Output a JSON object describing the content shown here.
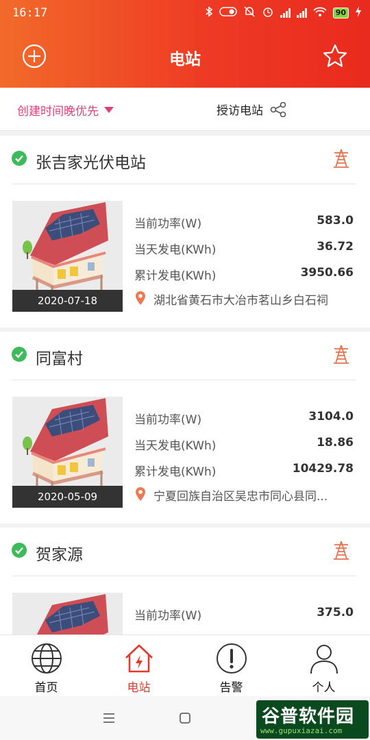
{
  "status": {
    "time": "16:17",
    "battery": "90"
  },
  "header": {
    "title": "电站",
    "add_icon": "plus-circle-icon",
    "favorite_icon": "star-icon"
  },
  "filter": {
    "sort_label": "创建时间晚优先",
    "visit_label": "授访电站",
    "share_icon": "share-icon"
  },
  "labels": {
    "power": "当前功率(W)",
    "today": "当天发电(KWh)",
    "total": "累计发电(KWh)"
  },
  "stations": [
    {
      "name": "张吉家光伏电站",
      "date": "2020-07-18",
      "power": "583.0",
      "today": "36.72",
      "total": "3950.66",
      "address": "湖北省黄石市大冶市茗山乡白石祠"
    },
    {
      "name": "同富村",
      "date": "2020-05-09",
      "power": "3104.0",
      "today": "18.86",
      "total": "10429.78",
      "address": "宁夏回族自治区吴忠市同心县同..."
    },
    {
      "name": "贺家源",
      "power": "375.0"
    }
  ],
  "nav": {
    "home": "首页",
    "station": "电站",
    "alarm": "告警",
    "profile": "个人"
  },
  "watermark": {
    "main": "谷普软件园",
    "sub": "www.gupuxiazai.com"
  },
  "colors": {
    "header_start": "#f26a2a",
    "header_end": "#e92a1e",
    "accent_pink": "#e04079",
    "ok_green": "#3dbb5a",
    "tower_orange": "#e8724f"
  }
}
